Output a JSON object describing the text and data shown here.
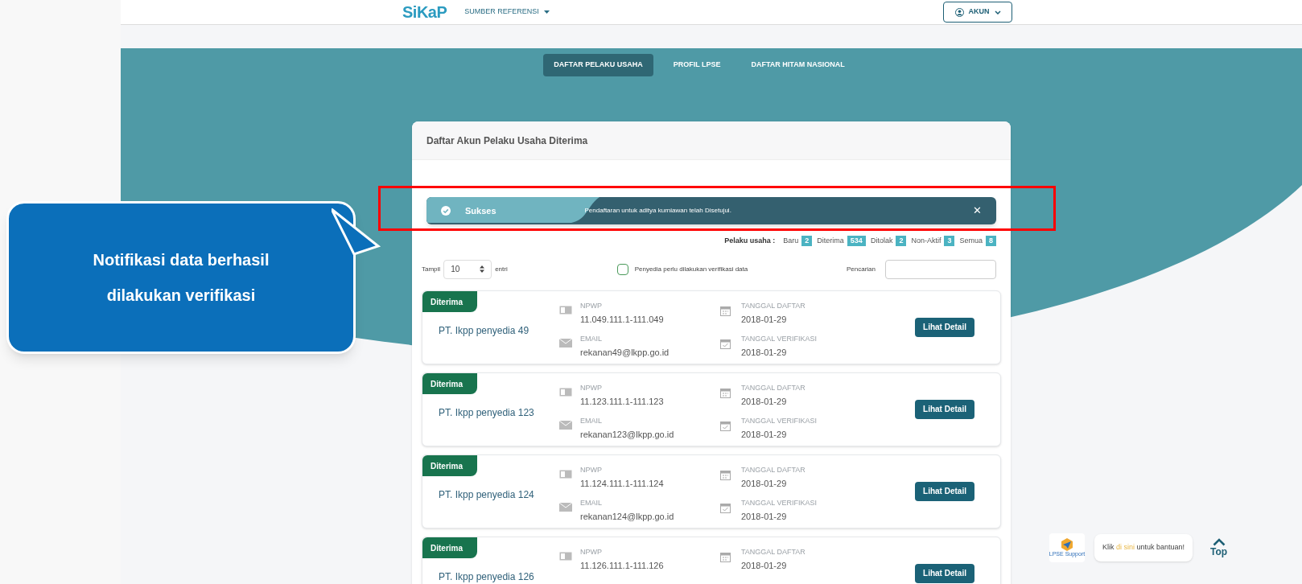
{
  "header": {
    "logo": "SiKaP",
    "menu": "SUMBER REFERENSI",
    "account": "AKUN"
  },
  "tabs": [
    {
      "label": "DAFTAR PELAKU USAHA",
      "selected": true
    },
    {
      "label": "PROFIL LPSE",
      "selected": false
    },
    {
      "label": "DAFTAR HITAM NASIONAL",
      "selected": false
    }
  ],
  "card": {
    "title": "Daftar Akun Pelaku Usaha Diterima"
  },
  "alert": {
    "title": "Sukses",
    "message": "Pendaftaran untuk aditya kurniawan telah Disetujui.",
    "close": "✕"
  },
  "counts": {
    "label": "Pelaku usaha :",
    "items": [
      {
        "label": "Baru",
        "count": "2"
      },
      {
        "label": "Diterima",
        "count": "534"
      },
      {
        "label": "Ditolak",
        "count": "2"
      },
      {
        "label": "Non-Aktif",
        "count": "3"
      },
      {
        "label": "Semua",
        "count": "8"
      }
    ]
  },
  "filters": {
    "show_label": "Tampil",
    "show_value": "10",
    "show_suffix": "entri",
    "checkbox": {
      "label": "Penyedia perlu dilakukan verifikasi data",
      "checked": false
    },
    "search_label": "Pencarian"
  },
  "rows": [
    {
      "status": "Diterima",
      "name": "PT. Ikpp penyedia 49",
      "npwp_label": "NPWP",
      "npwp": "11.049.111.1-111.049",
      "email_label": "EMAIL",
      "email": "rekanan49@lkpp.go.id",
      "registered_label": "TANGGAL DAFTAR",
      "registered": "2018-01-29",
      "verified_label": "TANGGAL VERIFIKASI",
      "verified": "2018-01-29",
      "button": "Lihat Detail"
    },
    {
      "status": "Diterima",
      "name": "PT. Ikpp penyedia 123",
      "npwp_label": "NPWP",
      "npwp": "11.123.111.1-111.123",
      "email_label": "EMAIL",
      "email": "rekanan123@lkpp.go.id",
      "registered_label": "TANGGAL DAFTAR",
      "registered": "2018-01-29",
      "verified_label": "TANGGAL VERIFIKASI",
      "verified": "2018-01-29",
      "button": "Lihat Detail"
    },
    {
      "status": "Diterima",
      "name": "PT. Ikpp penyedia 124",
      "npwp_label": "NPWP",
      "npwp": "11.124.111.1-111.124",
      "email_label": "EMAIL",
      "email": "rekanan124@lkpp.go.id",
      "registered_label": "TANGGAL DAFTAR",
      "registered": "2018-01-29",
      "verified_label": "TANGGAL VERIFIKASI",
      "verified": "2018-01-29",
      "button": "Lihat Detail"
    },
    {
      "status": "Diterima",
      "name": "PT. Ikpp penyedia 126",
      "npwp_label": "NPWP",
      "npwp": "11.126.111.1-111.126",
      "registered_label": "TANGGAL DAFTAR",
      "registered": "2018-01-29",
      "button": "Lihat Detail"
    }
  ],
  "callout": {
    "text": "Notifikasi data berhasil dilakukan verifikasi"
  },
  "support": {
    "logo_caption": "LPSE Support",
    "message": "Klik **di sini** untuk bantuan!",
    "top": "Top"
  }
}
